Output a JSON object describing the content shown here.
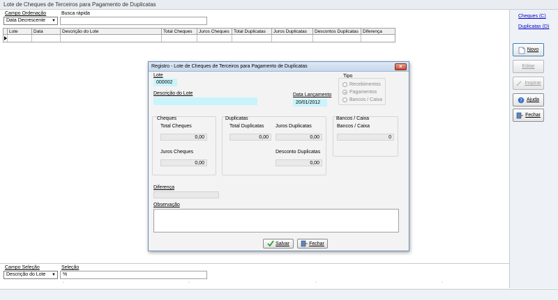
{
  "window": {
    "title": "Lote de Cheques de Terceiros para Pagamento de Duplicatas"
  },
  "top_filters": {
    "order_label": "Campo Ordenação",
    "order_value": "Data Decrescente",
    "search_label": "Busca rápida",
    "search_value": ""
  },
  "grid": {
    "columns": [
      "Lote",
      "Data",
      "Descrição do Lote",
      "Total Cheques",
      "Juros Cheques",
      "Total Duplicatas",
      "Juros Duplicatas",
      "Descontos Duplicatas",
      "Diferença"
    ]
  },
  "right_panel": {
    "link_cheques": "Cheques (C)",
    "link_duplicatas": "Duplicatas (D)",
    "btn_novo": "Novo",
    "btn_editar": "Editar",
    "btn_inspirar": "Inspirar",
    "btn_ajuda": "Ajuda",
    "btn_fechar": "Fechar"
  },
  "bottom_filters": {
    "field_label": "Campo Seleção",
    "field_value": "Descrição do Lote",
    "selection_label": "Seleção",
    "selection_value": "%"
  },
  "dialog": {
    "title": "Registro - Lote de Cheques de Terceiros para Pagamento de Duplicatas",
    "lote_label": "Lote",
    "lote_value": "000002",
    "tipo_label": "Tipo",
    "tipo_options": [
      "Recebimentos",
      "Pagamentos",
      "Bancos / Caixa"
    ],
    "tipo_selected": "Pagamentos",
    "descricao_label": "Descrição do Lote",
    "descricao_value": "",
    "data_label": "Data Lançamento",
    "data_value": "20/01/2012",
    "cheques": {
      "group_label": "Cheques",
      "total_label": "Total Cheques",
      "total_value": "0,00",
      "juros_label": "Juros Cheques",
      "juros_value": "0,00"
    },
    "duplicatas": {
      "group_label": "Duplicatas",
      "total_label": "Total Duplicatas",
      "total_value": "0,00",
      "juros_label": "Juros Duplicatas",
      "juros_value": "0,00",
      "desconto_label": "Desconto Duplicatas",
      "desconto_value": "0,00"
    },
    "bancos": {
      "group_label": "Bancos / Caixa",
      "label": "Bancos / Caixa",
      "value": "0"
    },
    "diferenca_label": "Diferença",
    "diferenca_value": "",
    "observacao_label": "Observação",
    "observacao_value": "",
    "btn_salvar": "Salvar",
    "btn_fechar": "Fechar"
  },
  "colors": {
    "cyan_field": "#c9f4fb",
    "title_bar": "#c7d8ec",
    "close_button": "#c9472f",
    "link": "#0000cc"
  }
}
